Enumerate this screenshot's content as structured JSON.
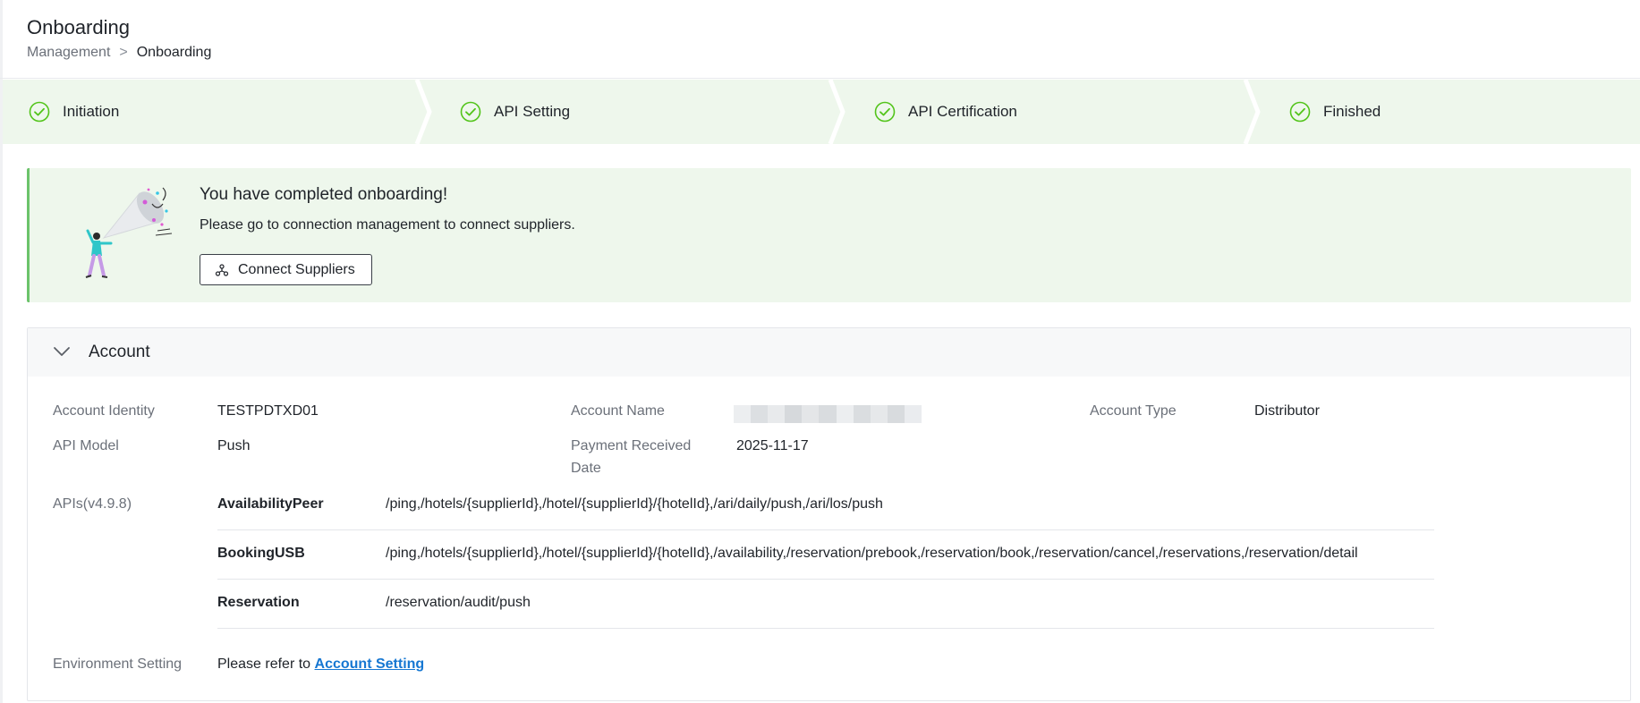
{
  "header": {
    "title": "Onboarding",
    "breadcrumb": {
      "parent": "Management",
      "separator": ">",
      "current": "Onboarding"
    }
  },
  "steps": [
    {
      "label": "Initiation",
      "status": "done"
    },
    {
      "label": "API Setting",
      "status": "done"
    },
    {
      "label": "API Certification",
      "status": "done"
    },
    {
      "label": "Finished",
      "status": "done"
    }
  ],
  "banner": {
    "title": "You have completed onboarding!",
    "text": "Please go to connection management to connect suppliers.",
    "button_label": "Connect Suppliers"
  },
  "account": {
    "section_title": "Account",
    "identity_label": "Account Identity",
    "identity_value": "TESTPDTXD01",
    "name_label": "Account Name",
    "name_value_redacted": true,
    "type_label": "Account Type",
    "type_value": "Distributor",
    "api_model_label": "API Model",
    "api_model_value": "Push",
    "payment_label_line1": "Payment Received",
    "payment_label_line2": "Date",
    "payment_value": "2025-11-17",
    "apis_label": "APIs(v4.9.8)",
    "apis": [
      {
        "name": "AvailabilityPeer",
        "paths": "/ping,/hotels/{supplierId},/hotel/{supplierId}/{hotelId},/ari/daily/push,/ari/los/push"
      },
      {
        "name": "BookingUSB",
        "paths": "/ping,/hotels/{supplierId},/hotel/{supplierId}/{hotelId},/availability,/reservation/prebook,/reservation/book,/reservation/cancel,/reservations,/reservation/detail"
      },
      {
        "name": "Reservation",
        "paths": "/reservation/audit/push"
      }
    ],
    "env_label": "Environment Setting",
    "env_text": "Please refer to",
    "env_link": "Account Setting"
  },
  "colors": {
    "accent_green": "#52c41a",
    "step_bg": "#eef7ec",
    "link_blue": "#1677d2"
  }
}
